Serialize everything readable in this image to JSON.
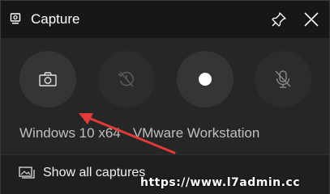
{
  "window": {
    "title": "Capture",
    "title_icon": "capture-widget-icon",
    "pin_icon": "pin-icon",
    "close_icon": "close-icon"
  },
  "buttons": [
    {
      "name": "screenshot",
      "icon": "camera-icon",
      "enabled": true
    },
    {
      "name": "record-last-30s",
      "icon": "record-history-icon",
      "enabled": false
    },
    {
      "name": "start-recording",
      "icon": "record-dot-icon",
      "enabled": true
    },
    {
      "name": "mic",
      "icon": "microphone-off-icon",
      "enabled": false
    }
  ],
  "capture_target": "Windows 10 x64 - VMware Workstation",
  "footer": {
    "label": "Show all captures",
    "icon": "gallery-icon"
  },
  "watermark": "https://www.l7admin.cc",
  "colors": {
    "background": "#262626",
    "titlebar": "#171717",
    "button": "#353535",
    "arrow": "#e03a3a"
  }
}
